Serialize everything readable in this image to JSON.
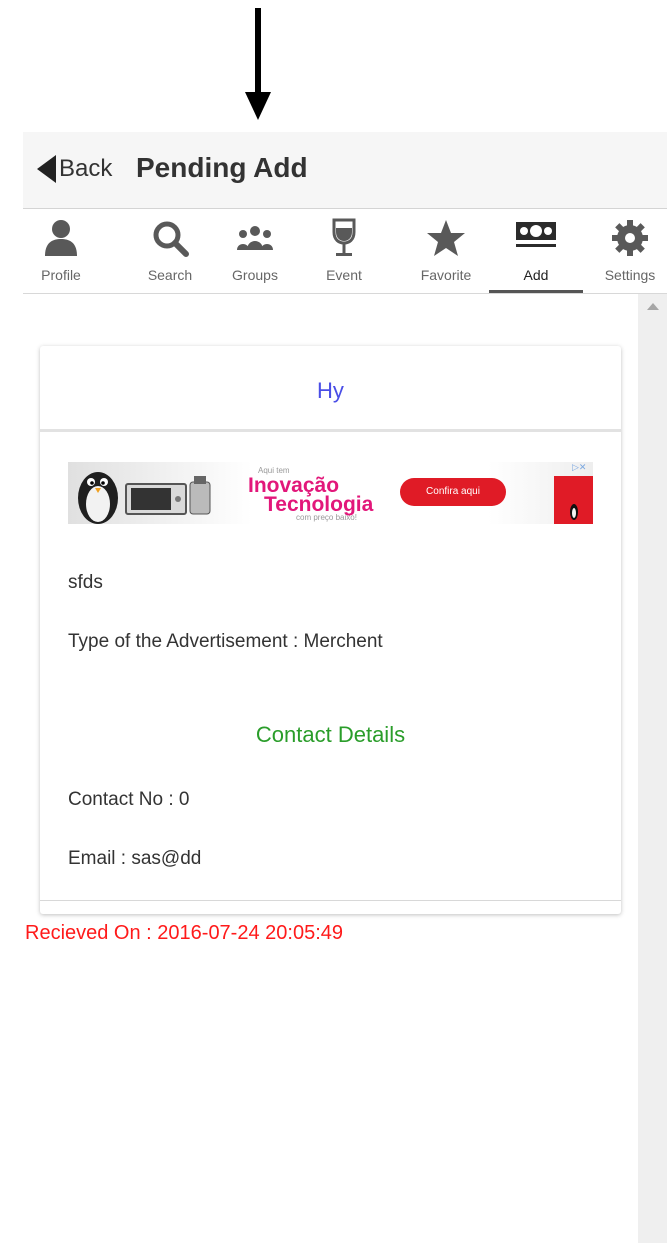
{
  "header": {
    "back_label": "Back",
    "title": "Pending Add"
  },
  "tabs": [
    {
      "label": "Profile",
      "icon": "person-icon"
    },
    {
      "label": "Search",
      "icon": "search-icon"
    },
    {
      "label": "Groups",
      "icon": "groups-icon"
    },
    {
      "label": "Event",
      "icon": "wine-glass-icon"
    },
    {
      "label": "Favorite",
      "icon": "star-icon"
    },
    {
      "label": "Add",
      "icon": "money-icon",
      "active": true
    },
    {
      "label": "Settings",
      "icon": "gear-icon"
    }
  ],
  "ad": {
    "small_top": "Aqui tem",
    "line1": "Inovação",
    "line2": "Tecnologia",
    "line3": "com preço baixo!",
    "cta": "Confira aqui"
  },
  "card": {
    "title": "Hy",
    "description": "sfds",
    "ad_type": "Type of the Advertisement : Merchent",
    "contact_heading": "Contact Details",
    "contact_no": "Contact No : 0",
    "email": "Email : sas@dd",
    "received": "Recieved On : 2016-07-24 20:05:49"
  },
  "colors": {
    "title_blue": "#4a4ee6",
    "contact_green": "#2a9d2a",
    "received_red": "#ff1a1a",
    "icon_gray": "#595959"
  }
}
